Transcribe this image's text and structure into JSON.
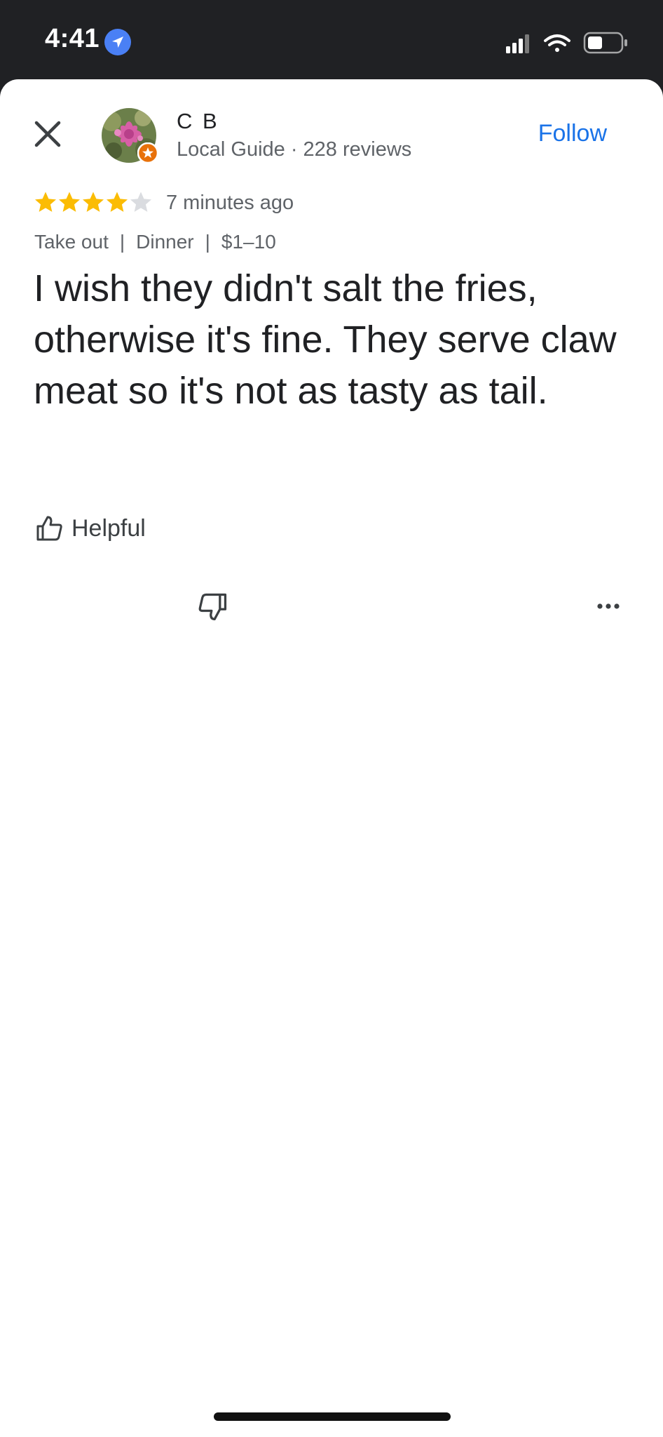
{
  "status_bar": {
    "time": "4:41",
    "icons": [
      "location-arrow-icon",
      "cellular-signal-icon",
      "wifi-icon",
      "battery-icon"
    ]
  },
  "reviewer": {
    "name": "C B",
    "meta": "Local Guide · 228 reviews",
    "badge_color": "#e8710a"
  },
  "follow_label": "Follow",
  "rating": {
    "stars": 4,
    "max": 5,
    "time_ago": "7 minutes ago"
  },
  "tags": [
    "Take out",
    "Dinner",
    "$1–10"
  ],
  "review_text": "I wish they didn't salt the fries, otherwise it's fine.  They serve claw meat so it's not as tasty as tail.",
  "actions": {
    "helpful_label": "Helpful"
  },
  "colors": {
    "accent": "#1a73e8",
    "star": "#fbbc04",
    "star_empty": "#dadce0",
    "status_bar": "#202124"
  }
}
